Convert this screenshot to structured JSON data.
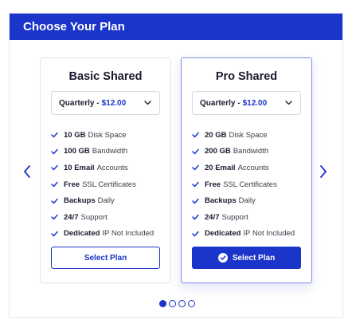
{
  "header": {
    "title": "Choose Your Plan"
  },
  "colors": {
    "accent": "#1b34c9",
    "header_bg": "#1b34c9"
  },
  "nav": {
    "prev_icon": "chevron-left-icon",
    "next_icon": "chevron-right-icon"
  },
  "plans": [
    {
      "name": "Basic Shared",
      "billing": {
        "period": "Quarterly -",
        "price": "$12.00"
      },
      "features": [
        {
          "bold": "10 GB",
          "text": "Disk Space"
        },
        {
          "bold": "100 GB",
          "text": "Bandwidth"
        },
        {
          "bold": "10 Email",
          "text": "Accounts"
        },
        {
          "bold": "Free",
          "text": "SSL Certificates"
        },
        {
          "bold": "Backups",
          "text": "Daily"
        },
        {
          "bold": "24/7",
          "text": "Support"
        },
        {
          "bold": "Dedicated",
          "text": "IP Not Included"
        }
      ],
      "button_label": "Select Plan",
      "selected": false
    },
    {
      "name": "Pro Shared",
      "billing": {
        "period": "Quarterly -",
        "price": "$12.00"
      },
      "features": [
        {
          "bold": "20 GB",
          "text": "Disk Space"
        },
        {
          "bold": "200 GB",
          "text": "Bandwidth"
        },
        {
          "bold": "20 Email",
          "text": "Accounts"
        },
        {
          "bold": "Free",
          "text": "SSL Certificates"
        },
        {
          "bold": "Backups",
          "text": "Daily"
        },
        {
          "bold": "24/7",
          "text": "Support"
        },
        {
          "bold": "Dedicated",
          "text": "IP Not Included"
        }
      ],
      "button_label": "Select Plan",
      "selected": true
    }
  ],
  "pagination": {
    "total": 4,
    "active": 1
  }
}
